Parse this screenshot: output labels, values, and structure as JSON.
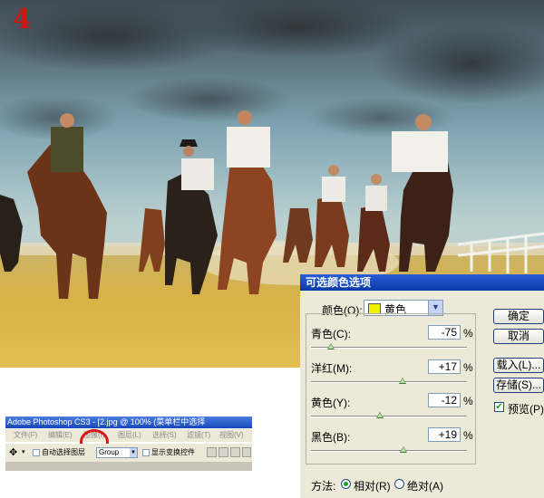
{
  "step_number": "4",
  "dialog": {
    "title": "可选颜色选项",
    "color_label": "颜色(O):",
    "color_value": "黄色",
    "swatch_color": "#f0f000",
    "sliders": [
      {
        "label": "青色(C):",
        "value": "-75",
        "unit": "%",
        "level": -75
      },
      {
        "label": "洋红(M):",
        "value": "+17",
        "unit": "%",
        "level": 17
      },
      {
        "label": "黄色(Y):",
        "value": "-12",
        "unit": "%",
        "level": -12
      },
      {
        "label": "黑色(B):",
        "value": "+19",
        "unit": "%",
        "level": 19
      }
    ],
    "buttons": {
      "ok": "确定",
      "cancel": "取消",
      "load": "载入(L)...",
      "save": "存储(S)..."
    },
    "preview_label": "预览(P)",
    "method_label": "方法:",
    "relative_label": "相对(R)",
    "absolute_label": "绝对(A)"
  },
  "photoshop": {
    "title": "Adobe Photoshop CS3 - [2.jpg @ 100% (菜单栏中选择",
    "menu": [
      "文件(F)",
      "编辑(E)",
      "图像(I)",
      "图层(L)",
      "选择(S)",
      "滤镜(T)",
      "视图(V)"
    ],
    "auto_select_label": "自动选择图层",
    "group_value": "Group",
    "show_transform_label": "显示变换控件"
  }
}
